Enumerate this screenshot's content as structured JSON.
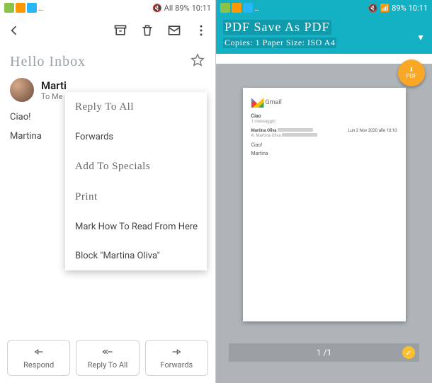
{
  "left": {
    "status": {
      "battery": "89%",
      "time": "10:11",
      "signal": "All"
    },
    "subject": "Hello Inbox",
    "sender": {
      "name": "Marti",
      "sub": "To Me"
    },
    "body": {
      "line1": "Ciao!",
      "line2": "Martina"
    },
    "menu": {
      "reply_all": "Reply To All",
      "forwards": "Forwards",
      "add_specials": "Add To Specials",
      "print": "Print",
      "mark_read": "Mark How To Read From Here",
      "block": "Block \"Martina Oliva\""
    },
    "actions": {
      "respond": "Respond",
      "reply_all": "Reply To All",
      "forwards": "Forwards"
    }
  },
  "right": {
    "status": {
      "battery": "89%",
      "time": "10:11"
    },
    "title": "PDF Save As PDF",
    "subtitle": "Copies: 1 Paper Size: ISO A4",
    "badge": "PDF",
    "page": {
      "gmail": "Gmail",
      "title": "Ciao",
      "msgcount": "1 messaggio",
      "from": "Martina Oliva",
      "to": "A: Martina Oliva",
      "date": "Lun 2 Nov 2020 alle 10:10",
      "l1": "Ciao!",
      "l2": "Martina"
    },
    "pager": "1 /1"
  }
}
